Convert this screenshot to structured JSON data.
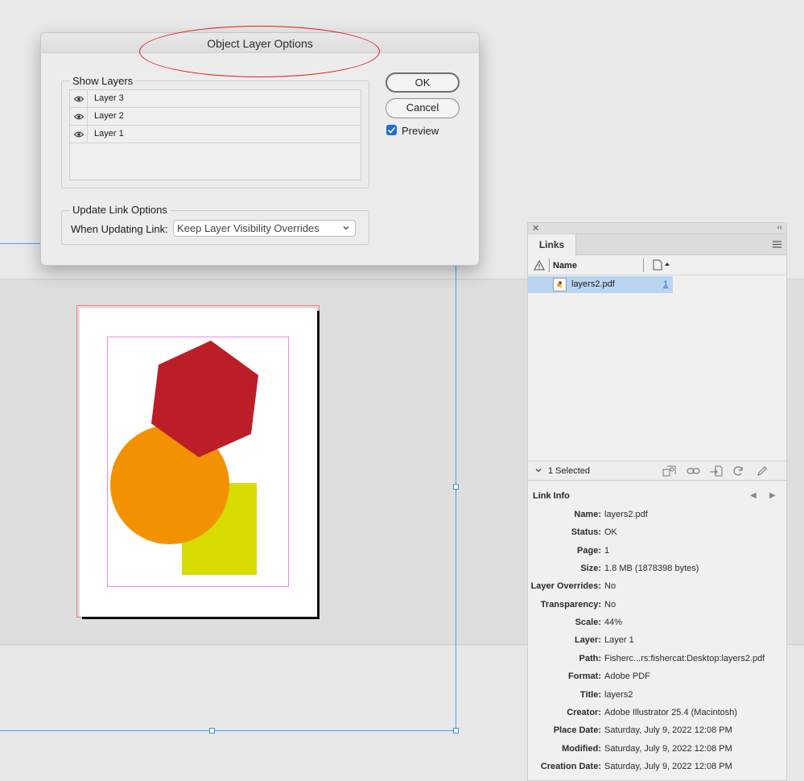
{
  "dialog": {
    "title": "Object Layer Options",
    "show_layers_label": "Show Layers",
    "layers": [
      {
        "name": "Layer 3",
        "visible": true
      },
      {
        "name": "Layer 2",
        "visible": true
      },
      {
        "name": "Layer 1",
        "visible": true
      }
    ],
    "ok_label": "OK",
    "cancel_label": "Cancel",
    "preview_label": "Preview",
    "preview_checked": true,
    "update_link_options_label": "Update Link Options",
    "when_updating_label": "When Updating Link:",
    "when_updating_value": "Keep Layer Visibility Overrides",
    "annotation_color": "#e01b1b"
  },
  "artwork": {
    "hexagon_color": "#bc1e28",
    "circle_color": "#f39200",
    "rectangle_color": "#d8dc00"
  },
  "links_panel": {
    "tab_label": "Links",
    "column_name": "Name",
    "rows": [
      {
        "name": "layers2.pdf",
        "page": "1",
        "selected": true
      }
    ],
    "selected_text": "1 Selected",
    "link_info_title": "Link Info",
    "info": [
      {
        "label": "Name:",
        "value": "layers2.pdf"
      },
      {
        "label": "Status:",
        "value": "OK"
      },
      {
        "label": "Page:",
        "value": "1"
      },
      {
        "label": "Size:",
        "value": "1.8 MB (1878398 bytes)"
      },
      {
        "label": "Layer Overrides:",
        "value": "No"
      },
      {
        "label": "Transparency:",
        "value": "No"
      },
      {
        "label": "Scale:",
        "value": "44%"
      },
      {
        "label": "Layer:",
        "value": "Layer 1"
      },
      {
        "label": "Path:",
        "value": "Fisherc...rs:fishercat:Desktop:layers2.pdf"
      },
      {
        "label": "Format:",
        "value": "Adobe PDF"
      },
      {
        "label": "Title:",
        "value": "layers2"
      },
      {
        "label": "Creator:",
        "value": "Adobe Illustrator 25.4 (Macintosh)"
      },
      {
        "label": "Place Date:",
        "value": "Saturday, July 9, 2022 12:08 PM"
      },
      {
        "label": "Modified:",
        "value": "Saturday, July 9, 2022 12:08 PM"
      },
      {
        "label": "Creation Date:",
        "value": "Saturday, July 9, 2022 12:08 PM"
      }
    ],
    "selection_color": "#b9d5f2"
  }
}
